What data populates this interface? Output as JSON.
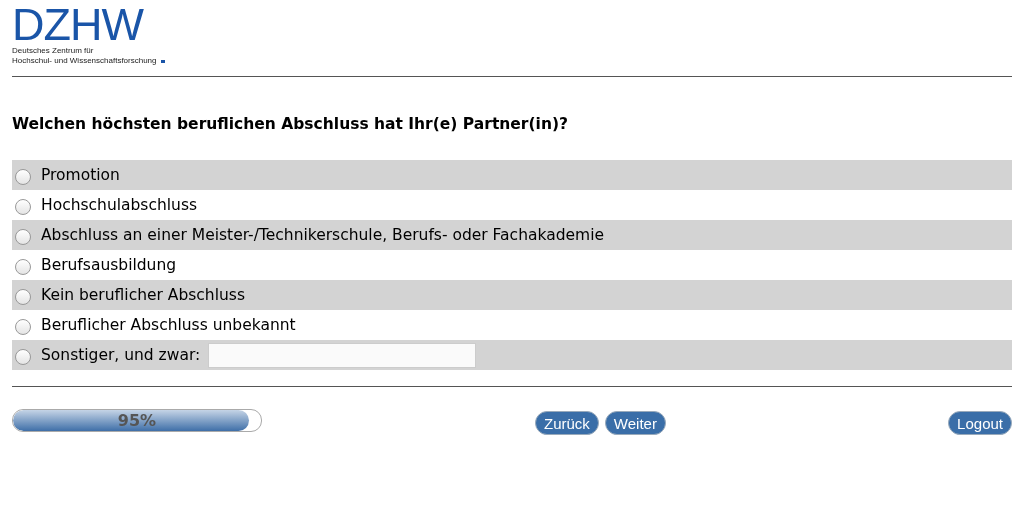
{
  "logo": {
    "title": "DZHW",
    "subtitle_lines": [
      "Deutsches Zentrum für",
      "Hochschul- und Wissenschaftsforschung"
    ]
  },
  "question": "Welchen höchsten beruflichen Abschluss hat Ihr(e) Partner(in)?",
  "options": [
    {
      "kind": "choice",
      "label": "Promotion",
      "selected": false
    },
    {
      "kind": "choice",
      "label": "Hochschulabschluss",
      "selected": false
    },
    {
      "kind": "choice",
      "label": "Abschluss an einer Meister-/Technikerschule, Berufs- oder Fachakademie",
      "selected": false
    },
    {
      "kind": "choice",
      "label": "Berufsausbildung",
      "selected": false
    },
    {
      "kind": "choice",
      "label": "Kein beruflicher Abschluss",
      "selected": false
    },
    {
      "kind": "choice",
      "label": "Beruflicher Abschluss unbekannt",
      "selected": false
    },
    {
      "kind": "other",
      "label": "Sonstiger, und zwar:",
      "selected": false
    }
  ],
  "progress": {
    "level": 0.95,
    "label": "95%"
  },
  "buttons": {
    "back": "Zurück",
    "next": "Weiter",
    "logout": "Logout"
  }
}
